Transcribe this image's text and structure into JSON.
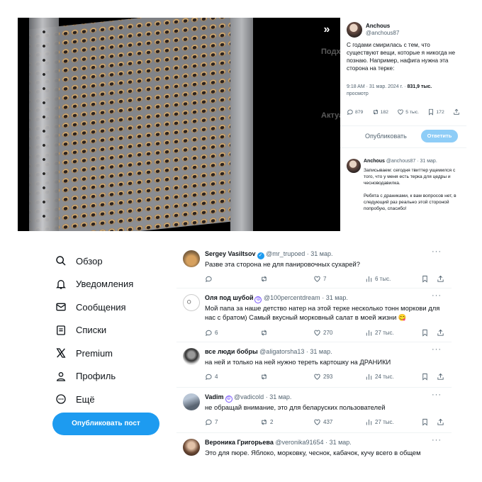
{
  "media": {
    "expand_icon": "chevrons-right-icon",
    "ghost_lines": [
      "Подход",
      "Актуал"
    ]
  },
  "tweet": {
    "author_name": "Anchous",
    "author_handle": "@anchous87",
    "text": "С годами смирилась с тем, что существуют вещи, которые я никогда не познаю. Например, нафига нужна эта сторона на терке:",
    "time": "9:18 AM · 31 мар. 2024 г. · ",
    "views": "831,9 тыс.",
    "views_label": "просмотр",
    "stats": {
      "replies": "879",
      "reposts": "182",
      "likes": "5 тыс.",
      "bookmarks": "172"
    },
    "reply_placeholder": "Опубликовать",
    "reply_button": "Ответить",
    "thread_reply": {
      "name": "Anchous",
      "handle": "@anchous87",
      "date": "· 31 мар.",
      "text1": "Записываем: сегодня твиттер ущемился с того, что у меня есть терка для цедры и чесноводавилка.",
      "text2": "Ребята с драниками, к вам вопросов нет, в следующий раз реально этой стороной попробую, спасибо!"
    }
  },
  "nav": {
    "items": [
      {
        "label": "Обзор",
        "icon": "search-icon"
      },
      {
        "label": "Уведомления",
        "icon": "bell-icon"
      },
      {
        "label": "Сообщения",
        "icon": "envelope-icon"
      },
      {
        "label": "Списки",
        "icon": "list-icon"
      },
      {
        "label": "Premium",
        "icon": "x-logo-icon"
      },
      {
        "label": "Профиль",
        "icon": "person-icon"
      },
      {
        "label": "Ещё",
        "icon": "more-circle-icon"
      }
    ],
    "post_button": "Опубликовать пост"
  },
  "replies": [
    {
      "name": "Sergey Vasiltsov",
      "handle": "@mr_trupoed",
      "date": "· 31 мар.",
      "text": "Разве эта сторона не для панировочных сухарей?",
      "replies": "",
      "reposts": "",
      "likes": "7",
      "views": "6 тыс."
    },
    {
      "name": "Оля под шубой",
      "handle": "@100percentdream",
      "date": "· 31 мар.",
      "text": "Мой папа за наше детство натер на этой терке несколько тонн моркови для нас с братом) Самый вкусный морковный салат в моей жизни 😋",
      "replies": "6",
      "reposts": "",
      "likes": "270",
      "views": "27 тыс."
    },
    {
      "name": "все люди бобры",
      "handle": "@aligatorsha13",
      "date": "· 31 мар.",
      "text": "на ней и только на ней нужно тереть картошку на ДРАНИКИ",
      "replies": "4",
      "reposts": "",
      "likes": "293",
      "views": "24 тыс."
    },
    {
      "name": "Vadim",
      "handle": "@vadicold",
      "date": "· 31 мар.",
      "text": "не обращай внимание, это для беларуских пользователей",
      "replies": "7",
      "reposts": "2",
      "likes": "437",
      "views": "27 тыс."
    },
    {
      "name": "Вероника Григорьева",
      "handle": "@veronika91654",
      "date": "· 31 мар.",
      "text": "Это для пюре. Яблоко, морковку, чеснок, кабачок, кучу всего в общем",
      "replies": "",
      "reposts": "",
      "likes": "",
      "views": ""
    }
  ],
  "colors": {
    "accent": "#1d9bf0",
    "muted": "#536471",
    "verified": "#1d9bf0",
    "premium": "#7856ff"
  }
}
